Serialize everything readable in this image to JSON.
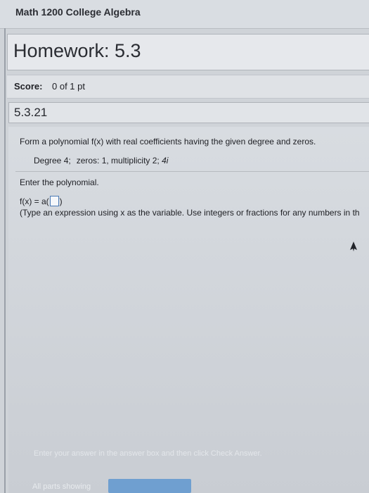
{
  "course": {
    "title": "Math 1200 College Algebra"
  },
  "homework": {
    "title": "Homework: 5.3"
  },
  "score": {
    "label": "Score:",
    "value": "0 of 1 pt"
  },
  "question": {
    "number": "5.3.21",
    "prompt": "Form a polynomial f(x) with real coefficients having the given degree and zeros.",
    "degree": "Degree 4;",
    "zeros_label": "zeros: 1, multiplicity 2;",
    "zeros_complex": "4i",
    "instruction": "Enter the polynomial.",
    "answer_prefix": "f(x) = a(",
    "answer_suffix": ")",
    "answer_value": "",
    "hint": "(Type an expression using x as the variable. Use integers or fractions for any numbers in th"
  },
  "footer": {
    "instruction": "Enter your answer in the answer box and then click Check Answer.",
    "parts": "All parts showing"
  },
  "colors": {
    "accent": "#4a7ab5",
    "check_button": "#6f9fd0"
  }
}
